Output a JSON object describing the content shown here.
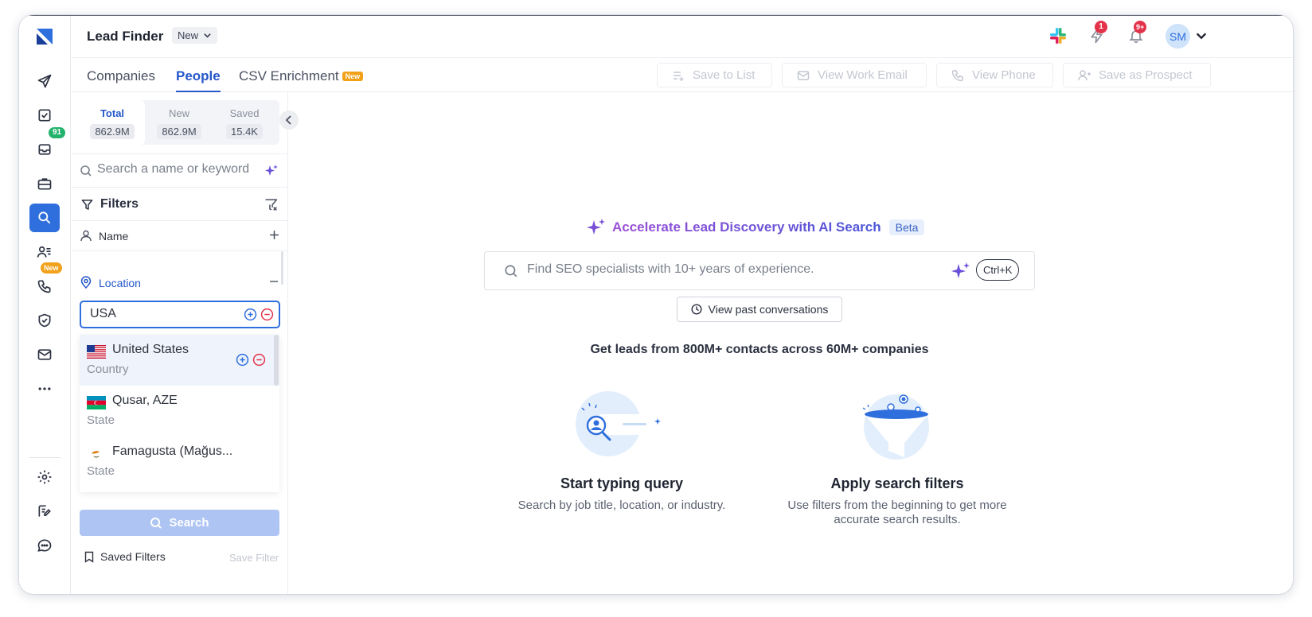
{
  "header": {
    "title": "Lead Finder",
    "title_dropdown": "New",
    "lightning_badge": "1",
    "bell_badge": "9+",
    "avatar_initials": "SM"
  },
  "rail": {
    "inbox_badge": "91",
    "calls_badge": "New"
  },
  "tabs": [
    {
      "label": "Companies"
    },
    {
      "label": "People"
    },
    {
      "label": "CSV Enrichment",
      "tag": "New"
    }
  ],
  "actions": {
    "save_to_list": "Save to List",
    "view_work_email": "View Work Email",
    "view_phone": "View Phone",
    "save_as_prospect": "Save as Prospect"
  },
  "counts": [
    {
      "label": "Total",
      "value": "862.9M"
    },
    {
      "label": "New",
      "value": "862.9M"
    },
    {
      "label": "Saved",
      "value": "15.4K"
    }
  ],
  "search": {
    "placeholder": "Search a name or keyword"
  },
  "filters": {
    "title": "Filters",
    "name_label": "Name",
    "location_label": "Location",
    "location_value": "USA"
  },
  "location_results": [
    {
      "name": "United States",
      "type": "Country"
    },
    {
      "name": "Qusar, AZE",
      "type": "State"
    },
    {
      "name": "Famagusta (Mağus...",
      "type": "State"
    }
  ],
  "panel_footer": {
    "search_button": "Search",
    "saved_filters": "Saved Filters",
    "save_filter": "Save Filter"
  },
  "main": {
    "ai_title": "Accelerate Lead Discovery with AI Search",
    "beta": "Beta",
    "ai_placeholder": "Find SEO specialists with 10+ years of experience.",
    "shortcut": "Ctrl+K",
    "past_conversations": "View past conversations",
    "get_leads": "Get leads from 800M+ contacts across 60M+ companies",
    "card1_title": "Start typing query",
    "card1_desc": "Search by job title, location, or industry.",
    "card2_title": "Apply search filters",
    "card2_desc": "Use filters from the beginning to get more accurate search results."
  },
  "colors": {
    "accent": "#2f6fdd",
    "active_tab": "#2457c9",
    "badge_red": "#e3324a",
    "badge_green": "#22b26b",
    "badge_orange": "#f1a11a"
  }
}
